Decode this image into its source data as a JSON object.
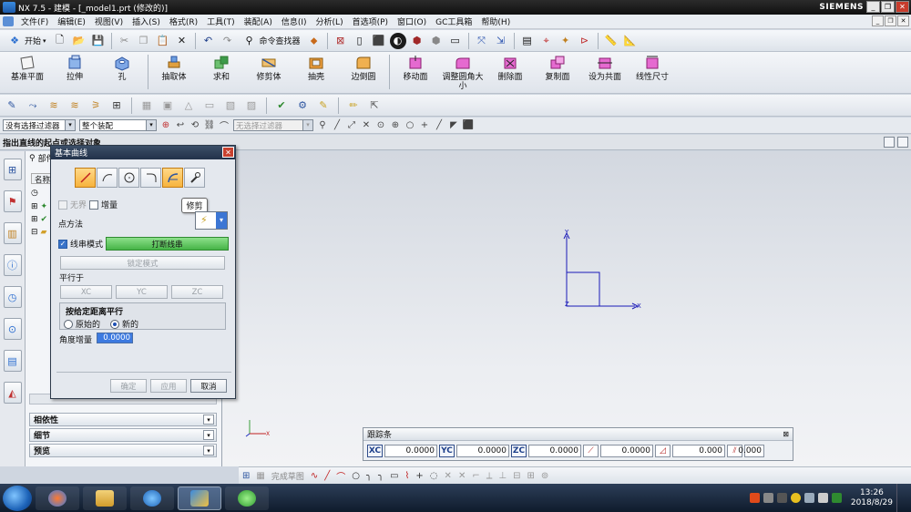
{
  "window": {
    "title": "NX 7.5 - 建模 - [_model1.prt  (修改的)]",
    "brand": "SIEMENS"
  },
  "menu": {
    "items": [
      "文件(F)",
      "编辑(E)",
      "视图(V)",
      "插入(S)",
      "格式(R)",
      "工具(T)",
      "装配(A)",
      "信息(I)",
      "分析(L)",
      "首选项(P)",
      "窗口(O)",
      "GC工具箱",
      "帮助(H)"
    ]
  },
  "toolbar": {
    "start_label": "开始",
    "command_finder": "命令查找器"
  },
  "feature_toolbar": {
    "left": [
      "基准平面",
      "拉伸",
      "孔",
      "抽取体",
      "求和",
      "修剪体",
      "抽壳",
      "边倒圆"
    ],
    "right": [
      "移动面",
      "调整圆角大小",
      "删除面",
      "复制面",
      "设为共面",
      "线性尺寸"
    ]
  },
  "selection_bar": {
    "filter": "没有选择过滤器",
    "scope": "整个装配",
    "disabled_combo": "无选择过滤器"
  },
  "cue_line": "指出直线的起点或选择对象",
  "nav": {
    "tab_label": "部件导航器",
    "column_header": "名称"
  },
  "accordion": [
    "相依性",
    "细节",
    "预览"
  ],
  "dialog": {
    "title": "基本曲线",
    "infinite_label": "无界",
    "increment_label": "增量",
    "point_method_label": "点方法",
    "string_mode_label": "线串模式",
    "break_string_label": "打断线串",
    "lock_mode_label": "锁定模式",
    "parallel_label": "平行于",
    "xc": "XC",
    "yc": "YC",
    "zc": "ZC",
    "offset_group_label": "按给定距离平行",
    "radio_original": "原始的",
    "radio_new": "新的",
    "angle_increment_label": "角度增量",
    "angle_increment_value": "0.0000",
    "ok": "确定",
    "apply": "应用",
    "cancel": "取消",
    "tooltip": "修剪"
  },
  "trackbar": {
    "title": "跟踪条",
    "fields": [
      {
        "label": "XC",
        "value": "0.0000"
      },
      {
        "label": "YC",
        "value": "0.0000"
      },
      {
        "label": "ZC",
        "value": "0.0000"
      }
    ],
    "extra_values": [
      "0.0000",
      "0.000",
      "0.000"
    ]
  },
  "sketch_bar": {
    "finish_sketch": "完成草图"
  },
  "taskbar": {
    "time": "13:26",
    "date": "2018/8/29"
  },
  "colors": {
    "accent": "#3973c9",
    "title_bar": "#22324a",
    "csys": "#1a1ab8",
    "close": "#c83c2c"
  }
}
